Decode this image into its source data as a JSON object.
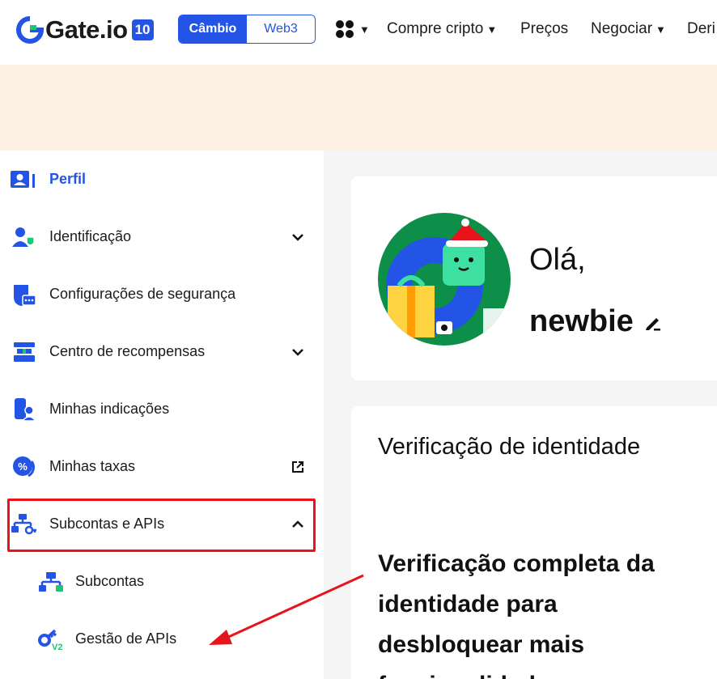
{
  "header": {
    "logo_text": "Gate.io",
    "logo_badge": "10",
    "switch": {
      "active": "Câmbio",
      "inactive": "Web3"
    },
    "nav": [
      {
        "label": "Compre cripto",
        "caret": "▼"
      },
      {
        "label": "Preços",
        "caret": ""
      },
      {
        "label": "Negociar",
        "caret": "▼"
      },
      {
        "label": "Deri",
        "caret": ""
      }
    ],
    "apps_caret": "▼"
  },
  "sidebar": {
    "items": [
      {
        "label": "Perfil",
        "icon": "profile-card-icon",
        "chevron": ""
      },
      {
        "label": "Identificação",
        "icon": "identity-shield-icon",
        "chevron": "down"
      },
      {
        "label": "Configurações de segurança",
        "icon": "security-shield-icon",
        "chevron": ""
      },
      {
        "label": "Centro de recompensas",
        "icon": "rewards-icon",
        "chevron": "down"
      },
      {
        "label": "Minhas indicações",
        "icon": "referral-icon",
        "chevron": ""
      },
      {
        "label": "Minhas taxas",
        "icon": "percent-icon",
        "chevron": "external"
      },
      {
        "label": "Subcontas e APIs",
        "icon": "subaccount-api-icon",
        "chevron": "up"
      }
    ],
    "sub_items": [
      {
        "label": "Subcontas",
        "icon": "subaccount-icon"
      },
      {
        "label": "Gestão de APIs",
        "icon": "api-key-icon",
        "badge": "V2"
      }
    ]
  },
  "profile": {
    "greeting": "Olá,",
    "username": "newbie"
  },
  "verification": {
    "title": "Verificação de identidade",
    "description": "Verificação completa da identidade para desbloquear mais funcionalidades"
  },
  "colors": {
    "brand": "#2354e6",
    "banner": "#fdf1e4",
    "highlight": "#e8141b",
    "main_bg": "#f5f5f5"
  }
}
